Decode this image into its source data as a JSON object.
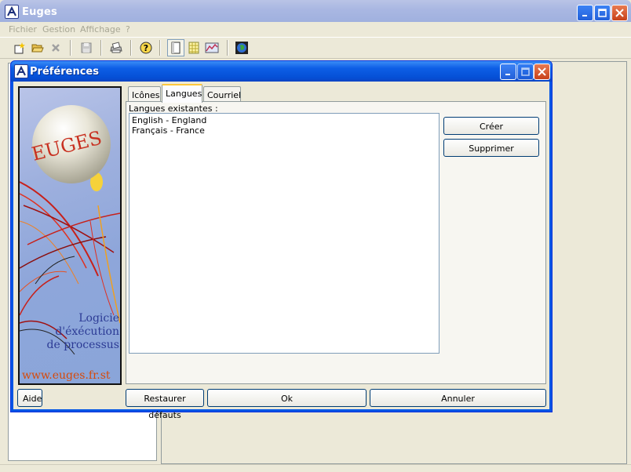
{
  "app": {
    "title": "Euges",
    "menu": [
      "Fichier",
      "Gestion",
      "Affichage",
      "?"
    ]
  },
  "toolbar": {
    "icons": [
      "new-document-icon",
      "open-folder-icon",
      "delete-icon",
      "save-icon",
      "print-icon",
      "help-icon",
      "page-view-icon",
      "grid-view-icon",
      "chart-view-icon",
      "globe-icon"
    ]
  },
  "dialog": {
    "title": "Préférences",
    "tabs": [
      "Icônes",
      "Langues",
      "Courriel"
    ],
    "active_tab": "Langues",
    "languages_label": "Langues existantes :",
    "languages": [
      "English - England",
      "Français - France"
    ],
    "create_button": "Créer",
    "delete_button": "Supprimer",
    "help_button": "Aide",
    "restore_button": "Restaurer défauts",
    "ok_button": "Ok",
    "cancel_button": "Annuler",
    "splash": {
      "logo_text": "EUGES",
      "tagline": [
        "Logicie",
        "d'éxécution",
        "de processus"
      ],
      "url": "www.euges.fr.st"
    }
  },
  "colors": {
    "xp_blue": "#0055e5",
    "title_inactive": "#a9b7e2",
    "splash_text": "#2c3b95",
    "splash_url": "#d64a0a"
  }
}
